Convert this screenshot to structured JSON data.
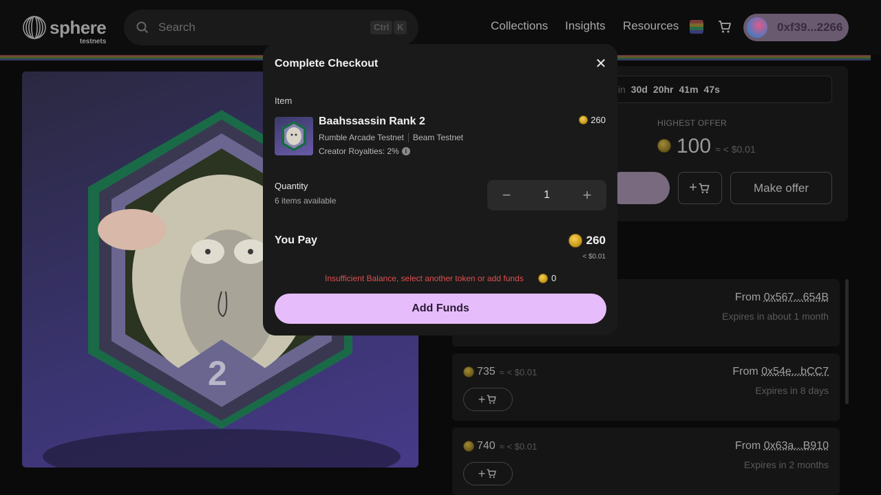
{
  "header": {
    "logo_name": "sphere",
    "logo_sub": "testnets",
    "search_placeholder": "Search",
    "kbd": [
      "Ctrl",
      "K"
    ],
    "nav": [
      "Collections",
      "Insights",
      "Resources"
    ],
    "wallet_address": "0xf39...2266"
  },
  "background": {
    "timer_prefix": "s in",
    "timer": [
      "30d",
      "20hr",
      "41m",
      "47s"
    ],
    "highest_offer_label": "HIGHEST OFFER",
    "highest_offer_value": "100",
    "highest_offer_usd": "≈ < $0.01",
    "make_offer_label": "Make offer",
    "listings": [
      {
        "price": "",
        "usd": "",
        "from_label": "From",
        "from_addr": "0x567...654B",
        "expires": "Expires in about 1 month"
      },
      {
        "price": "735",
        "usd": "≈ < $0.01",
        "from_label": "From",
        "from_addr": "0x54e...bCC7",
        "expires": "Expires in 8 days"
      },
      {
        "price": "740",
        "usd": "≈ < $0.01",
        "from_label": "From",
        "from_addr": "0x63a...B910",
        "expires": "Expires in 2 months"
      }
    ],
    "nft_rank": "2"
  },
  "modal": {
    "title": "Complete Checkout",
    "item_label": "Item",
    "item_name": "Baahssassin Rank 2",
    "item_price": "260",
    "collection": "Rumble Arcade Testnet",
    "network": "Beam Testnet",
    "royalties": "Creator Royalties: 2%",
    "quantity_label": "Quantity",
    "available": "6 items available",
    "quantity": "1",
    "you_pay_label": "You Pay",
    "you_pay_value": "260",
    "you_pay_usd": "< $0.01",
    "warning": "Insufficient Balance, select another token or add funds",
    "balance": "0",
    "add_funds_label": "Add Funds"
  },
  "colors": {
    "accent": "#e6bdfa",
    "warning": "#e05050",
    "modal_bg": "#1a1a1a"
  },
  "icons": [
    "search-icon",
    "cart-icon",
    "close-icon",
    "info-icon",
    "minus-icon",
    "plus-icon",
    "coin-icon",
    "flag-icon"
  ]
}
